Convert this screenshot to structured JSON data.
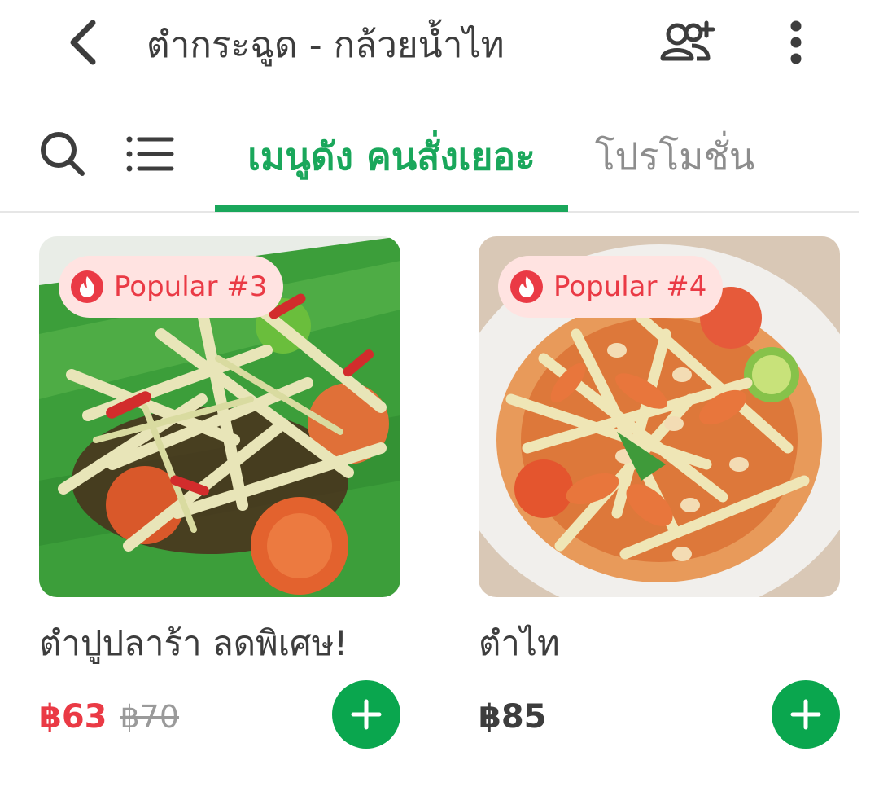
{
  "header": {
    "title": "ตำกระฉูด - กล้วยน้ำไท"
  },
  "tabs": [
    {
      "label": "เมนูดัง คนสั่งเยอะ",
      "active": true
    },
    {
      "label": "โปรโมชั่น",
      "active": false
    }
  ],
  "colors": {
    "accent": "#1aa75b",
    "badge_bg": "#ffe3e1",
    "badge_text": "#ea3a45",
    "add_button": "#0aa64e"
  },
  "items": [
    {
      "badge": "Popular #3",
      "name": "ตำปูปลาร้า ลดพิเศษ!",
      "price": "฿63",
      "original_price": "฿70"
    },
    {
      "badge": "Popular #4",
      "name": "ตำไท",
      "price": "฿85"
    }
  ],
  "icons": {
    "back": "chevron-left-icon",
    "add_friend": "add-friend-icon",
    "more": "more-vertical-icon",
    "search": "search-icon",
    "list": "list-icon",
    "fire": "fire-icon",
    "plus": "plus-icon"
  }
}
